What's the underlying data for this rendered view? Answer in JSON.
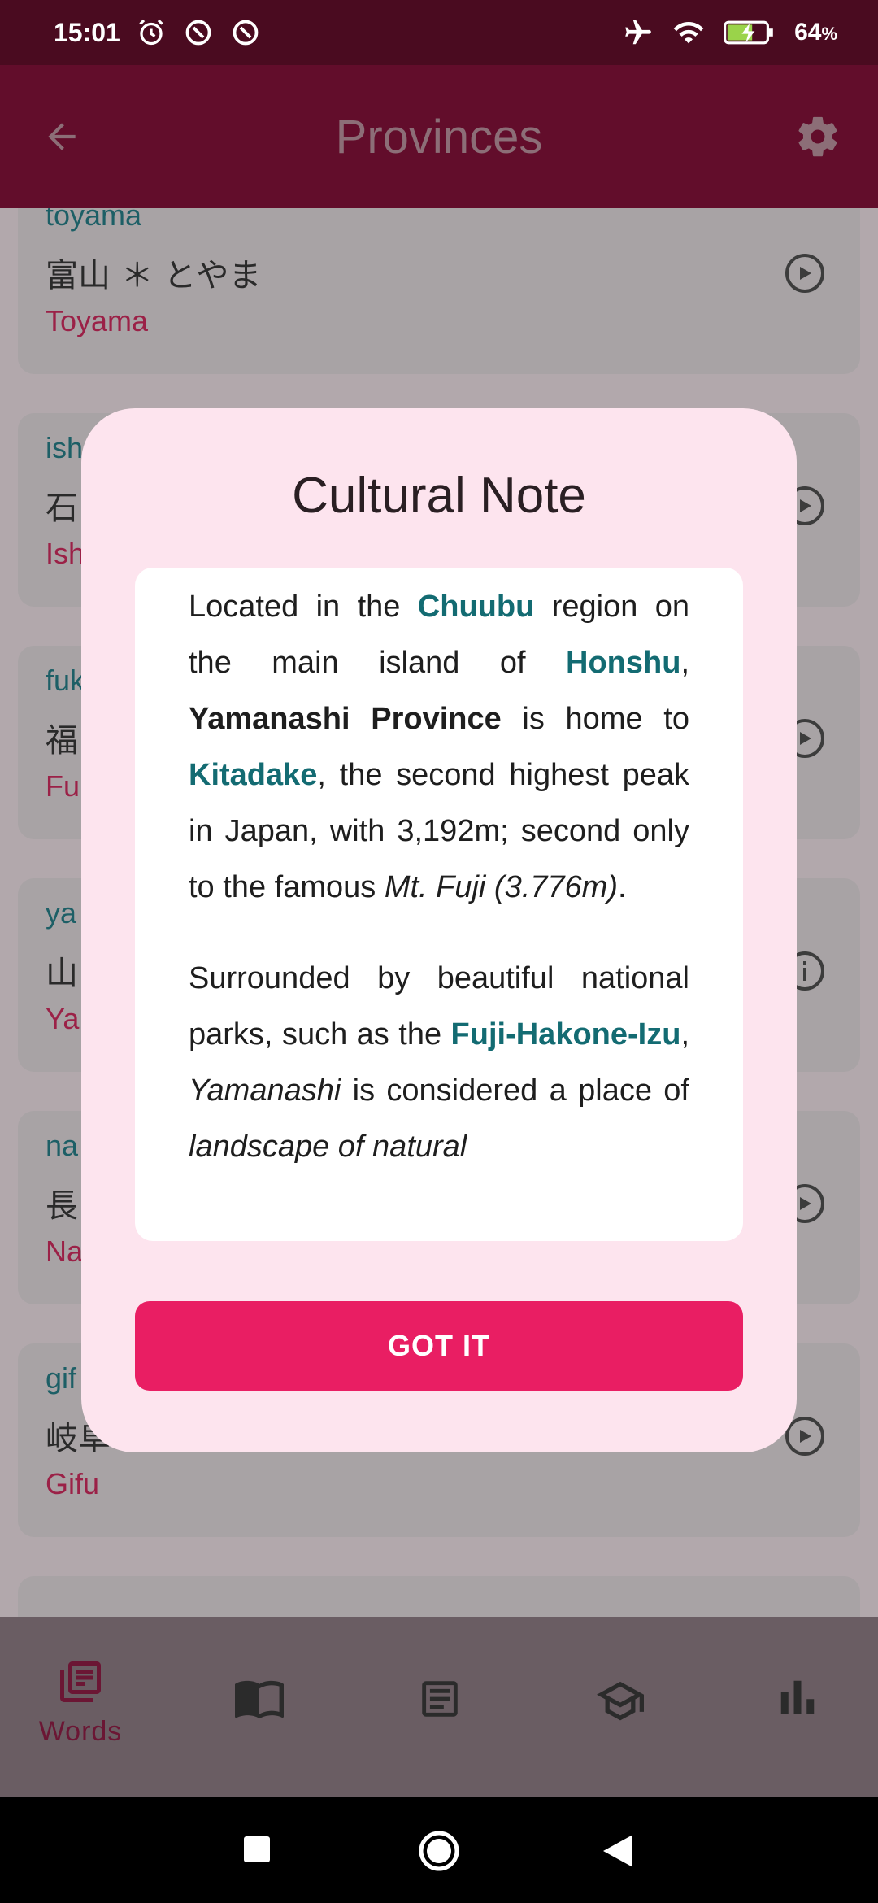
{
  "status_bar": {
    "time": "15:01",
    "battery": "64",
    "battery_unit": "%",
    "icons": [
      "alarm-icon",
      "data-saver-icon",
      "data-saver-icon",
      "airplane-icon",
      "wifi-icon",
      "battery-charging-icon"
    ]
  },
  "app_bar": {
    "title": "Provinces",
    "back_icon": "arrow-left-icon",
    "settings_icon": "gear-icon"
  },
  "list": {
    "cards": [
      {
        "romaji": "toyama",
        "kana": "富山 ＊ とやま",
        "english": "Toyama",
        "action_icon": "play-circle-icon"
      },
      {
        "romaji": "ish",
        "kana": "石",
        "english": "Ish",
        "action_icon": "play-circle-icon"
      },
      {
        "romaji": "fuk",
        "kana": "福",
        "english": "Fu",
        "action_icon": "play-circle-icon"
      },
      {
        "romaji": "ya",
        "kana": "山",
        "english": "Ya",
        "action_icon": "info-circle-icon"
      },
      {
        "romaji": "na",
        "kana": "長",
        "english": "Na",
        "action_icon": "play-circle-icon"
      },
      {
        "romaji": "gif",
        "kana": "岐阜 ＊ ぎふ",
        "english": "Gifu",
        "action_icon": "play-circle-icon"
      }
    ]
  },
  "dialog": {
    "title": "Cultural Note",
    "p1": {
      "t1": "Located in the ",
      "chuubu": "Chuubu",
      "t2": " region on the main island of ",
      "honshu": "Honshu",
      "t3": ", ",
      "yamanashi_province": "Yamanashi Province",
      "t4": " is home to ",
      "kitadake": "Kitadake",
      "t5": ", the second highest peak in Japan, with 3,192m; second only to the famous ",
      "mt_fuji": "Mt. Fuji (3.776m)",
      "t6": "."
    },
    "p2": {
      "t1": "Surrounded by beautiful national parks, such as the ",
      "fuji_hakone_izu": "Fuji-Hakone-Izu",
      "t2": ", ",
      "yamanashi": "Yamanashi",
      "t3": " is considered a place of ",
      "landscape": "landscape of natural"
    },
    "button": "GOT IT"
  },
  "bottom_nav": {
    "items": [
      {
        "label": "Words",
        "icon": "library-books-icon",
        "active": true
      },
      {
        "label": "",
        "icon": "open-book-icon"
      },
      {
        "label": "",
        "icon": "article-icon"
      },
      {
        "label": "",
        "icon": "graduation-cap-icon"
      },
      {
        "label": "",
        "icon": "bar-chart-icon"
      }
    ]
  },
  "system_nav": {
    "icons": [
      "recents-square-icon",
      "home-circle-icon",
      "back-triangle-icon"
    ]
  },
  "colors": {
    "status_bar": "#4a0b20",
    "app_bar": "#620d2b",
    "accent": "#e91e63",
    "highlight_teal": "#136b72",
    "dialog_bg": "#fde4ee"
  }
}
